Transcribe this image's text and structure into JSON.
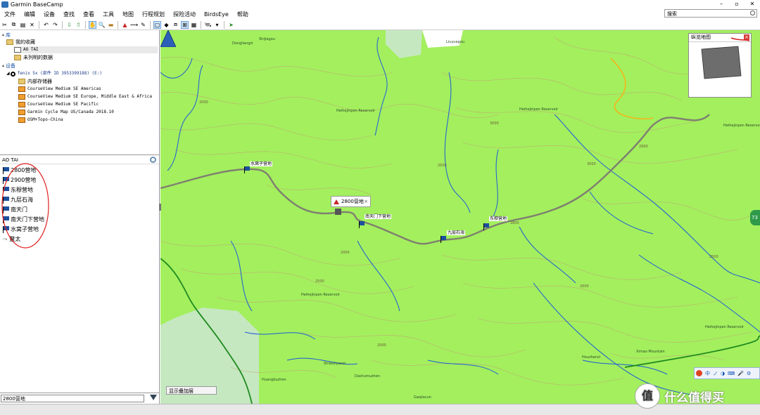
{
  "window": {
    "title": "Garmin BaseCamp",
    "buttons": [
      "–",
      "▫",
      "✕"
    ]
  },
  "menu": [
    "文件",
    "编辑",
    "设备",
    "查找",
    "查看",
    "工具",
    "地图",
    "行程规划",
    "探险活动",
    "BirdsEye",
    "帮助"
  ],
  "search": {
    "placeholder": "搜索"
  },
  "library": {
    "root": "库",
    "my_collection": "我的收藏",
    "ao_tai": "AO TAI",
    "unlisted": "未列明的数据",
    "devices_header": "设备",
    "device": "fenix 5x (部件 ID 3953399188) (E:)",
    "internal_storage": "内部存储器",
    "maps": [
      "CourseView Medium SE Americas",
      "CourseView Medium SE Europe, Middle East & Africa",
      "CourseView Medium SE Pacific",
      "Garmin Cycle Map US/Canada 2018.10",
      "OSM+Topo-China"
    ]
  },
  "list": {
    "title": "AO TAI",
    "items": [
      "2800营地",
      "2900营地",
      "东穆营地",
      "九层石海",
      "南天门",
      "南天门下营地",
      "水窝子营地",
      "鳌太"
    ]
  },
  "filter": {
    "value": "2800营地"
  },
  "map": {
    "overview_title": "纵览地图",
    "overlay_button": "显示叠加层",
    "popup_label": "2800营地",
    "reservoir": "Heihejinpen Reservoir",
    "waypoints": [
      {
        "label": "水窝子营地"
      },
      {
        "label": "南天门下营地"
      },
      {
        "label": "九层石海"
      },
      {
        "label": "东穆营地"
      }
    ],
    "contours": [
      "2000",
      "2500",
      "3000",
      "2900",
      "2800",
      "2500",
      "2000",
      "2600",
      "3000",
      "2000",
      "2500"
    ],
    "places": [
      "Dongliangzi",
      "Shijiagou",
      "Liuyuegou",
      "Huangbuzhen",
      "Ximao Mountain",
      "Houzhenzi",
      "Shiwuliyanzi",
      "Dashumuzhen",
      "Gaojiacun"
    ],
    "ime": [
      "中",
      "ノ",
      "◑",
      "⌨",
      "🎤",
      "⚙"
    ],
    "pin": "73"
  },
  "watermark": {
    "symbol": "值",
    "text": "什么值得买"
  },
  "colors": {
    "map_bg": "#a3ef5e",
    "forest": "#c5e8c0",
    "route": "#7f7f70",
    "stream": "#1e5bd8",
    "boundary": "#1f8a1f"
  }
}
